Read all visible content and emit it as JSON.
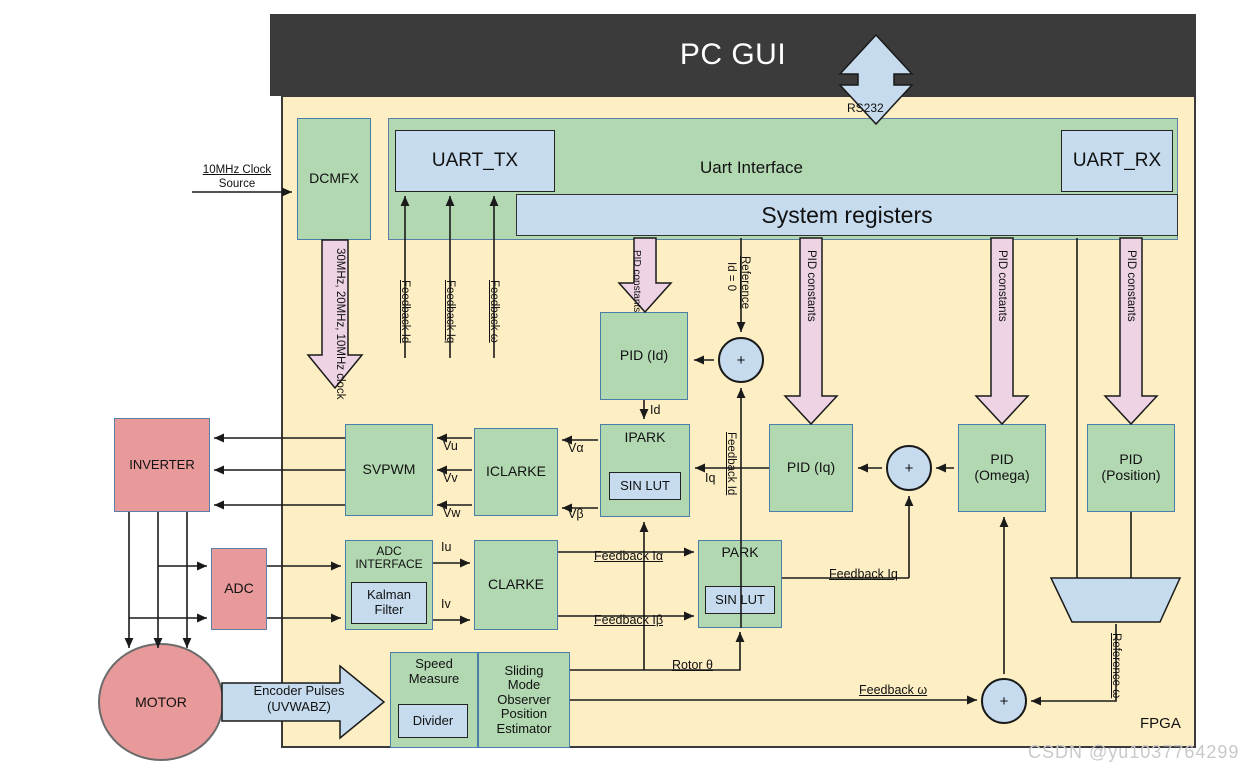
{
  "header": {
    "title": "PC GUI"
  },
  "link": {
    "rs232": "RS232"
  },
  "fpga": {
    "label": "FPGA"
  },
  "uart": {
    "interface_label": "Uart Interface",
    "tx": "UART_TX",
    "rx": "UART_RX",
    "system_registers": "System registers"
  },
  "clock": {
    "source": "10MHz Clock\nSource",
    "source_line1": "10MHz Clock",
    "source_line2": "Source",
    "dcmfx": "DCMFX",
    "outputs": "30MHz, 20MHz, 10MHz clock"
  },
  "blocks": {
    "pid_id": "PID (Id)",
    "pid_iq": "PID (Iq)",
    "pid_omega_l1": "PID",
    "pid_omega_l2": "(Omega)",
    "pid_position_l1": "PID",
    "pid_position_l2": "(Position)",
    "ipark": "IPARK",
    "iclarke": "ICLARKE",
    "svpwm": "SVPWM",
    "clarke": "CLARKE",
    "park": "PARK",
    "sin_lut": "SIN LUT",
    "adc_interface_l1": "ADC",
    "adc_interface_l2": "INTERFACE",
    "kalman_l1": "Kalman",
    "kalman_l2": "Filter",
    "speed_measure_l1": "Speed",
    "speed_measure_l2": "Measure",
    "divider": "Divider",
    "smo": "Sliding\nMode\nObserver\nPosition\nEstimator",
    "smo_l1": "Sliding",
    "smo_l2": "Mode",
    "smo_l3": "Observer",
    "smo_l4": "Position",
    "smo_l5": "Estimator",
    "inverter": "INVERTER",
    "adc": "ADC",
    "motor": "MOTOR",
    "summer": "+"
  },
  "signals": {
    "feedback_id_tx": "Feedback Id",
    "feedback_iq_tx": "Feedback Iq",
    "feedback_w_tx": "Feedback ω",
    "pid_constants": "PID constants",
    "pid_constants_2line": "PID\nconstants",
    "reference_id": "Reference\nId = 0",
    "reference_id_l1": "Reference",
    "reference_id_l2": "Id = 0",
    "feedback_id": "Feedback Id",
    "feedback_iq": "Feedback Iq",
    "feedback_ia": "Feedback Iα",
    "feedback_ib": "Feedback Iβ",
    "feedback_omega": "Feedback ω",
    "reference_omega": "Reference ω",
    "rotor_theta": "Rotor θ",
    "id": "Id",
    "iq": "Iq",
    "iu": "Iu",
    "iv": "Iv",
    "valpha": "Vα",
    "vbeta": "Vβ",
    "vu": "Vu",
    "vv": "Vv",
    "vw": "Vw",
    "encoder_l1": "Encoder Pulses",
    "encoder_l2": "(UVWABZ)"
  },
  "watermark": {
    "text": "CSDN @yu1037764299"
  },
  "colors": {
    "pc_gui_bg": "#3b3b3b",
    "fpga_bg": "#fdeec3",
    "green_block": "#b2d8b2",
    "blue_block": "#c6dcee",
    "red_block": "#e89a9a",
    "pink_arrow": "#edd3e4",
    "border": "#4a7ea8"
  }
}
